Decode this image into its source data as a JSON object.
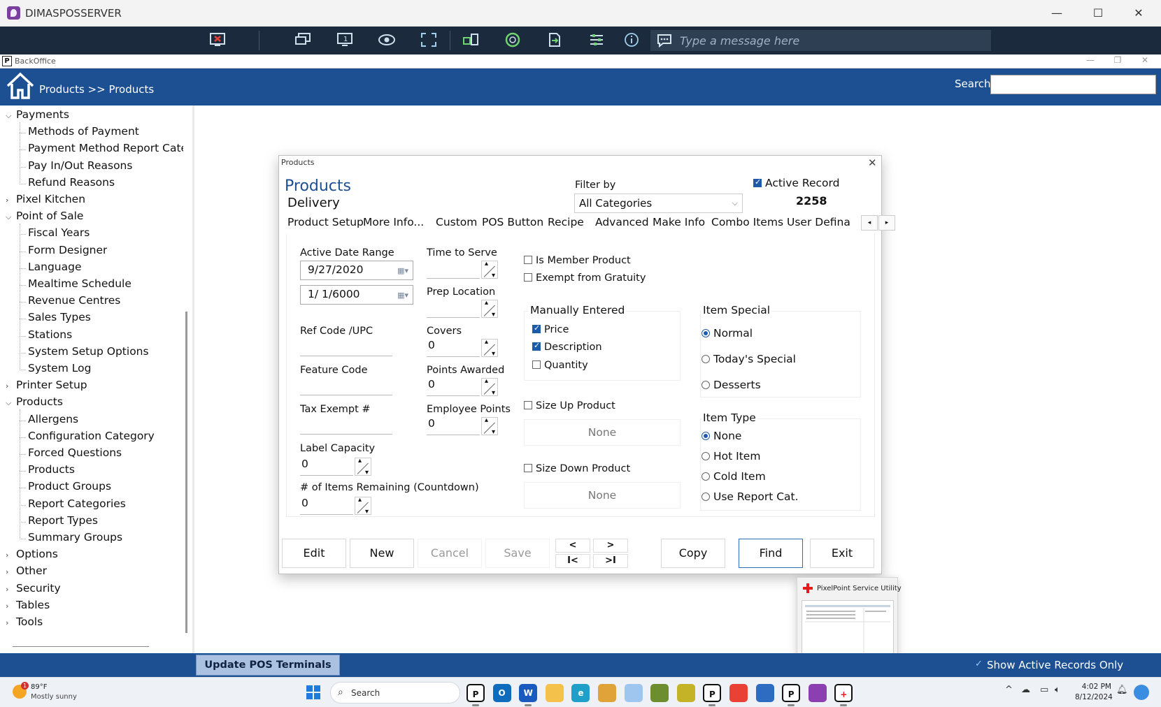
{
  "window": {
    "title": "DIMASPOSSERVER",
    "message_placeholder": "Type a message here",
    "controls": {
      "minimize": "—",
      "maximize": "☐",
      "close": "✕"
    },
    "toolbar_icons": [
      "disconnect-icon",
      "monitors-icon",
      "single-monitor-icon",
      "view-icon",
      "fullscreen-icon",
      "transfer-icon",
      "record-icon",
      "file-transfer-icon",
      "settings-icon",
      "info-icon",
      "chat-icon"
    ]
  },
  "backoffice": {
    "title": "BackOffice",
    "minimize": "—",
    "restore": "❐",
    "close": "✕",
    "breadcrumb": "Products >> Products",
    "search_label": "Search",
    "search_value": ""
  },
  "sidebar": {
    "groups": [
      {
        "label": "Payments",
        "expanded": true,
        "children": [
          "Methods of Payment",
          "Payment Method Report Cate",
          "Pay In/Out Reasons",
          "Refund Reasons"
        ]
      },
      {
        "label": "Pixel Kitchen",
        "expanded": false,
        "children": []
      },
      {
        "label": "Point of Sale",
        "expanded": true,
        "children": [
          "Fiscal Years",
          "Form Designer",
          "Language",
          "Mealtime Schedule",
          "Revenue Centres",
          "Sales Types",
          "Stations",
          "System Setup Options",
          "System Log"
        ]
      },
      {
        "label": "Printer Setup",
        "expanded": false,
        "children": []
      },
      {
        "label": "Products",
        "expanded": true,
        "children": [
          "Allergens",
          "Configuration Category",
          "Forced Questions",
          "Products",
          "Product Groups",
          "Report Categories",
          "Report Types",
          "Summary Groups"
        ]
      },
      {
        "label": "Options",
        "expanded": false,
        "children": []
      },
      {
        "label": "Other",
        "expanded": false,
        "children": []
      },
      {
        "label": "Security",
        "expanded": false,
        "children": []
      },
      {
        "label": "Tables",
        "expanded": false,
        "children": []
      },
      {
        "label": "Tools",
        "expanded": false,
        "children": []
      }
    ]
  },
  "dialog": {
    "caption": "Products",
    "close": "✕",
    "title": "Products",
    "subtitle": "Delivery",
    "filter_label": "Filter by",
    "filter_value": "All Categories",
    "active_record_label": "Active Record",
    "active_record_checked": true,
    "record_number": "2258",
    "tabs": [
      "Product Setup",
      "More Info...",
      "Custom",
      "POS Button",
      "Recipe",
      "Advanced",
      "Make Info",
      "Combo Items",
      "User Defina"
    ],
    "tab_prev": "◂",
    "tab_next": "▸",
    "active_tab": "More Info...",
    "fields": {
      "active_date_range_label": "Active Date Range",
      "date_from": "9/27/2020",
      "date_to": "1/  1/6000",
      "ref_code_label": "Ref Code /UPC",
      "ref_code_value": "",
      "feature_code_label": "Feature Code",
      "feature_code_value": "",
      "tax_exempt_label": "Tax Exempt #",
      "tax_exempt_value": "",
      "label_capacity_label": "Label Capacity",
      "label_capacity_value": "0",
      "items_remaining_label": "# of Items Remaining (Countdown)",
      "items_remaining_value": "0",
      "time_to_serve_label": "Time to Serve",
      "time_to_serve_value": "",
      "prep_location_label": "Prep Location",
      "prep_location_value": "",
      "covers_label": "Covers",
      "covers_value": "0",
      "points_awarded_label": "Points Awarded",
      "points_awarded_value": "0",
      "employee_points_label": "Employee Points",
      "employee_points_value": "0"
    },
    "checks": {
      "is_member_product": "Is Member Product",
      "exempt_gratuity": "Exempt from Gratuity",
      "size_up_product": "Size Up Product",
      "size_up_value": "None",
      "size_down_product": "Size Down Product",
      "size_down_value": "None"
    },
    "manually_entered": {
      "title": "Manually Entered",
      "options": [
        {
          "label": "Price",
          "checked": true
        },
        {
          "label": "Description",
          "checked": true
        },
        {
          "label": "Quantity",
          "checked": false
        }
      ]
    },
    "item_special": {
      "title": "Item Special",
      "options": [
        "Normal",
        "Today's Special",
        "Desserts"
      ],
      "selected": "Normal"
    },
    "item_type": {
      "title": "Item Type",
      "options": [
        "None",
        "Hot Item",
        "Cold Item",
        "Use Report Cat."
      ],
      "selected": "None"
    },
    "buttons": {
      "edit": "Edit",
      "new": "New",
      "cancel": "Cancel",
      "save": "Save",
      "prev": "<",
      "next": ">",
      "first": "I<",
      "last": ">I",
      "copy": "Copy",
      "find": "Find",
      "exit": "Exit"
    }
  },
  "preview": {
    "title": "PixelPoint Service Utility"
  },
  "statusbar": {
    "update_button": "Update POS Terminals",
    "show_active_label": "Show Active Records Only"
  },
  "taskbar": {
    "weather_temp": "89°F",
    "weather_condition": "Mostly sunny",
    "weather_badge": "1",
    "search_label": "Search",
    "time": "4:02 PM",
    "date": "8/12/2024",
    "tray_icons": [
      "chevron-up-icon",
      "cloud-icon",
      "network-icon",
      "volume-icon"
    ],
    "apps": [
      {
        "name": "pixelpoint",
        "label": "P",
        "color": "#ffffff",
        "fg": "#111111"
      },
      {
        "name": "outlook",
        "label": "O",
        "color": "#0f6cbd",
        "fg": "#ffffff"
      },
      {
        "name": "word",
        "label": "W",
        "color": "#185abd",
        "fg": "#ffffff"
      },
      {
        "name": "file-explorer",
        "label": "",
        "color": "#f4c24b",
        "fg": "#ffffff"
      },
      {
        "name": "edge",
        "label": "e",
        "color": "#1fa0c9",
        "fg": "#ffffff"
      },
      {
        "name": "app-yellow",
        "label": "",
        "color": "#e0a33a",
        "fg": "#ffffff"
      },
      {
        "name": "app-cloud",
        "label": "",
        "color": "#9fc6ee",
        "fg": "#ffffff"
      },
      {
        "name": "app-green",
        "label": "",
        "color": "#6c8e2f",
        "fg": "#ffffff"
      },
      {
        "name": "app-lime",
        "label": "",
        "color": "#c5b327",
        "fg": "#ffffff"
      },
      {
        "name": "pixelpoint-2",
        "label": "P",
        "color": "#ffffff",
        "fg": "#111111"
      },
      {
        "name": "chrome",
        "label": "",
        "color": "#e94235",
        "fg": "#ffffff"
      },
      {
        "name": "app-grid",
        "label": "",
        "color": "#2d6cc0",
        "fg": "#ffffff"
      },
      {
        "name": "pixelpoint-3",
        "label": "P",
        "color": "#ffffff",
        "fg": "#111111"
      },
      {
        "name": "remote-app",
        "label": "",
        "color": "#8b3fb0",
        "fg": "#ffffff"
      },
      {
        "name": "service-utility",
        "label": "+",
        "color": "#ffffff",
        "fg": "#e31b1b"
      }
    ]
  }
}
